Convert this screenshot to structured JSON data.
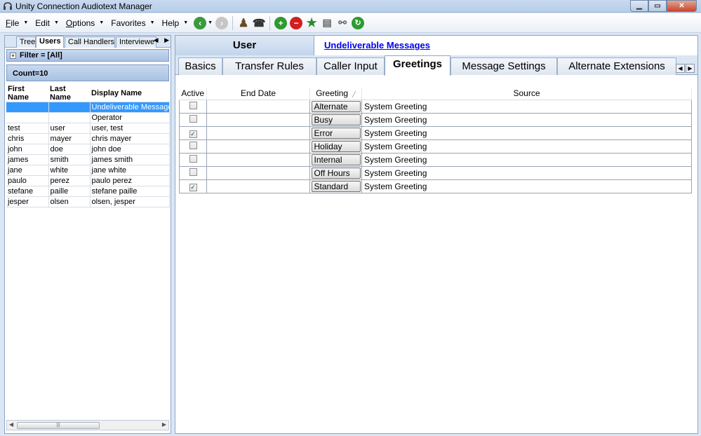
{
  "window": {
    "title": "Unity Connection Audiotext Manager"
  },
  "menu": {
    "items": [
      {
        "label": "File",
        "underline": "F",
        "rest": "ile"
      },
      {
        "label": "Edit",
        "underline": "",
        "rest": "Edit"
      },
      {
        "label": "Options",
        "underline": "O",
        "rest": "ptions"
      },
      {
        "label": "Favorites",
        "underline": "",
        "rest": "Favorites"
      },
      {
        "label": "Help",
        "underline": "",
        "rest": "Help"
      }
    ],
    "toolbar_icons": [
      "back-icon",
      "forward-icon",
      "user-icon",
      "phone-icon",
      "add-icon",
      "remove-icon",
      "favorite-star-icon",
      "document-icon",
      "link-icon",
      "refresh-icon"
    ]
  },
  "left": {
    "tabs": [
      "Tree",
      "Users",
      "Call Handlers",
      "Interviewe"
    ],
    "active_tab": "Users",
    "filter": "Filter = [All]",
    "count": "Count=10",
    "columns": [
      "First Name",
      "Last Name",
      "Display Name"
    ],
    "rows": [
      {
        "first": "",
        "last": "",
        "display": "Undeliverable Messages",
        "selected": true
      },
      {
        "first": "",
        "last": "",
        "display": "Operator",
        "selected": false
      },
      {
        "first": "test",
        "last": "user",
        "display": "user, test",
        "selected": false
      },
      {
        "first": "chris",
        "last": "mayer",
        "display": "chris mayer",
        "selected": false
      },
      {
        "first": "john",
        "last": "doe",
        "display": "john doe",
        "selected": false
      },
      {
        "first": "james",
        "last": "smith",
        "display": "james smith",
        "selected": false
      },
      {
        "first": "jane",
        "last": "white",
        "display": "jane white",
        "selected": false
      },
      {
        "first": "paulo",
        "last": "perez",
        "display": "paulo perez",
        "selected": false
      },
      {
        "first": "stefane",
        "last": "paille",
        "display": "stefane paille",
        "selected": false
      },
      {
        "first": "jesper",
        "last": "olsen",
        "display": "olsen, jesper",
        "selected": false
      }
    ]
  },
  "right": {
    "header_label": "User",
    "header_link": "Undeliverable Messages",
    "tabs": [
      "Basics",
      "Transfer Rules",
      "Caller Input",
      "Greetings",
      "Message Settings",
      "Alternate Extensions"
    ],
    "active_tab": "Greetings",
    "columns": [
      "Active",
      "End Date",
      "Greeting",
      "Source"
    ],
    "greetings": [
      {
        "active": false,
        "end_date": "",
        "greeting": "Alternate",
        "source": "System Greeting"
      },
      {
        "active": false,
        "end_date": "",
        "greeting": "Busy",
        "source": "System Greeting"
      },
      {
        "active": true,
        "end_date": "",
        "greeting": "Error",
        "source": "System Greeting"
      },
      {
        "active": false,
        "end_date": "",
        "greeting": "Holiday",
        "source": "System Greeting"
      },
      {
        "active": false,
        "end_date": "",
        "greeting": "Internal",
        "source": "System Greeting"
      },
      {
        "active": false,
        "end_date": "",
        "greeting": "Off Hours",
        "source": "System Greeting"
      },
      {
        "active": true,
        "end_date": "",
        "greeting": "Standard",
        "source": "System Greeting"
      }
    ]
  },
  "colors": {
    "selection": "#3399ff",
    "link": "#0000ee",
    "panel_border": "#8ea6c6"
  }
}
